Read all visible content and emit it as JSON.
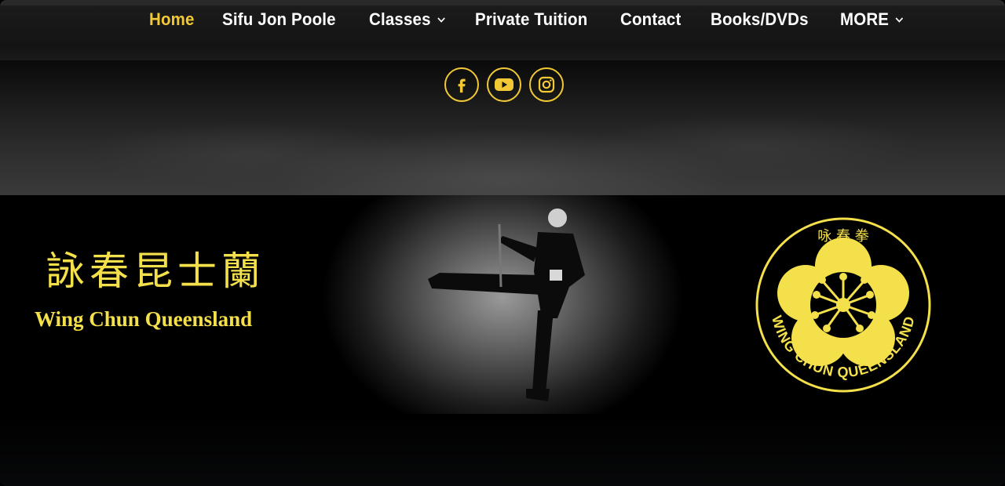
{
  "nav": {
    "items": [
      {
        "label": "Home",
        "active": true,
        "dropdown": false
      },
      {
        "label": "Sifu Jon Poole",
        "active": false,
        "dropdown": false
      },
      {
        "label": "Classes",
        "active": false,
        "dropdown": true
      },
      {
        "label": "Private Tuition",
        "active": false,
        "dropdown": false
      },
      {
        "label": "Contact",
        "active": false,
        "dropdown": false
      },
      {
        "label": "Books/DVDs",
        "active": false,
        "dropdown": false
      },
      {
        "label": "MORE",
        "active": false,
        "dropdown": true
      }
    ]
  },
  "socials": [
    "facebook-icon",
    "youtube-icon",
    "instagram-icon"
  ],
  "banner": {
    "chinese_title": "詠春昆士蘭",
    "english_title": "Wing Chun Queensland",
    "logo_chinese": "咏 春 拳",
    "logo_text": "WING CHUN QUEENSLAND"
  },
  "colors": {
    "accent": "#f2c935",
    "logo_yellow": "#f4e04a",
    "background": "#000000"
  }
}
